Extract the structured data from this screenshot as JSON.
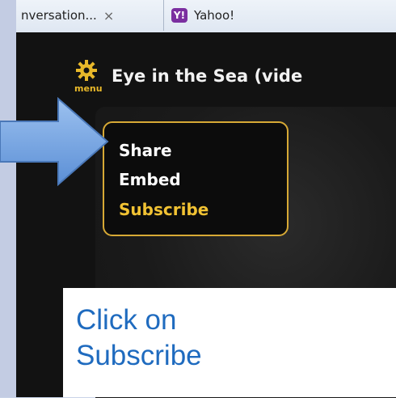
{
  "browser": {
    "tabs": [
      {
        "label": "nversation...",
        "close": "×"
      },
      {
        "label": "Yahoo!",
        "icon": "yahoo-icon",
        "icon_text": "Y!"
      }
    ]
  },
  "player": {
    "menu_icon": "gear-icon",
    "menu_label": "menu",
    "title": "Eye in the Sea (vide",
    "menu_items": [
      "Share",
      "Embed",
      "Subscribe"
    ],
    "highlight_color": "#f1c233"
  },
  "annotation": {
    "arrow": "arrow-right-icon",
    "caption_line1": "Click on",
    "caption_line2": "Subscribe",
    "caption_color": "#1f6bbf"
  }
}
